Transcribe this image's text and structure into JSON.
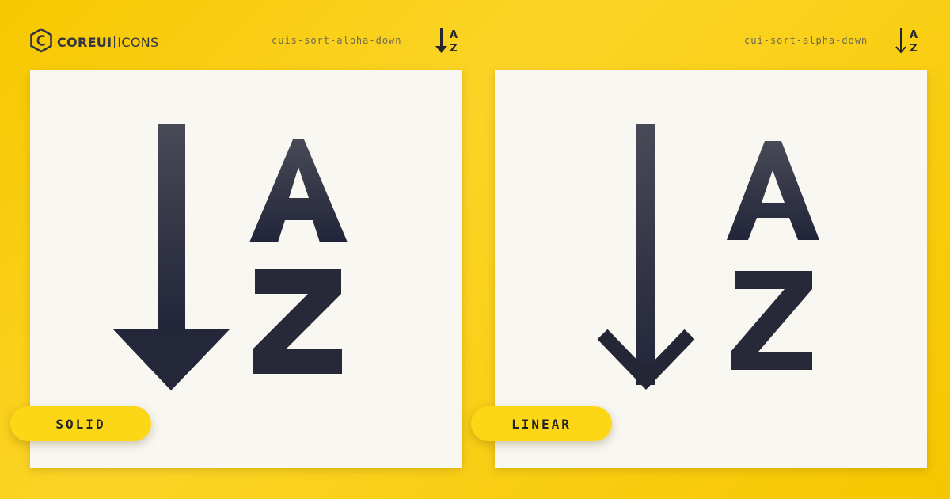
{
  "brand": {
    "logo_icon": "coreui-hexagon-logo",
    "name_bold": "COREUI",
    "name_light": "ICONS"
  },
  "panels": [
    {
      "icon_name": "cuis-sort-alpha-down",
      "style_label": "SOLID",
      "icon": "sort-alpha-down-solid-icon"
    },
    {
      "icon_name": "cui-sort-alpha-down",
      "style_label": "LINEAR",
      "icon": "sort-alpha-down-linear-icon"
    }
  ],
  "colors": {
    "background": "#f9cf15",
    "card": "#f8f7f2",
    "pill": "#fcd716",
    "ink_top": "#484a56",
    "ink_bottom": "#22243a"
  }
}
